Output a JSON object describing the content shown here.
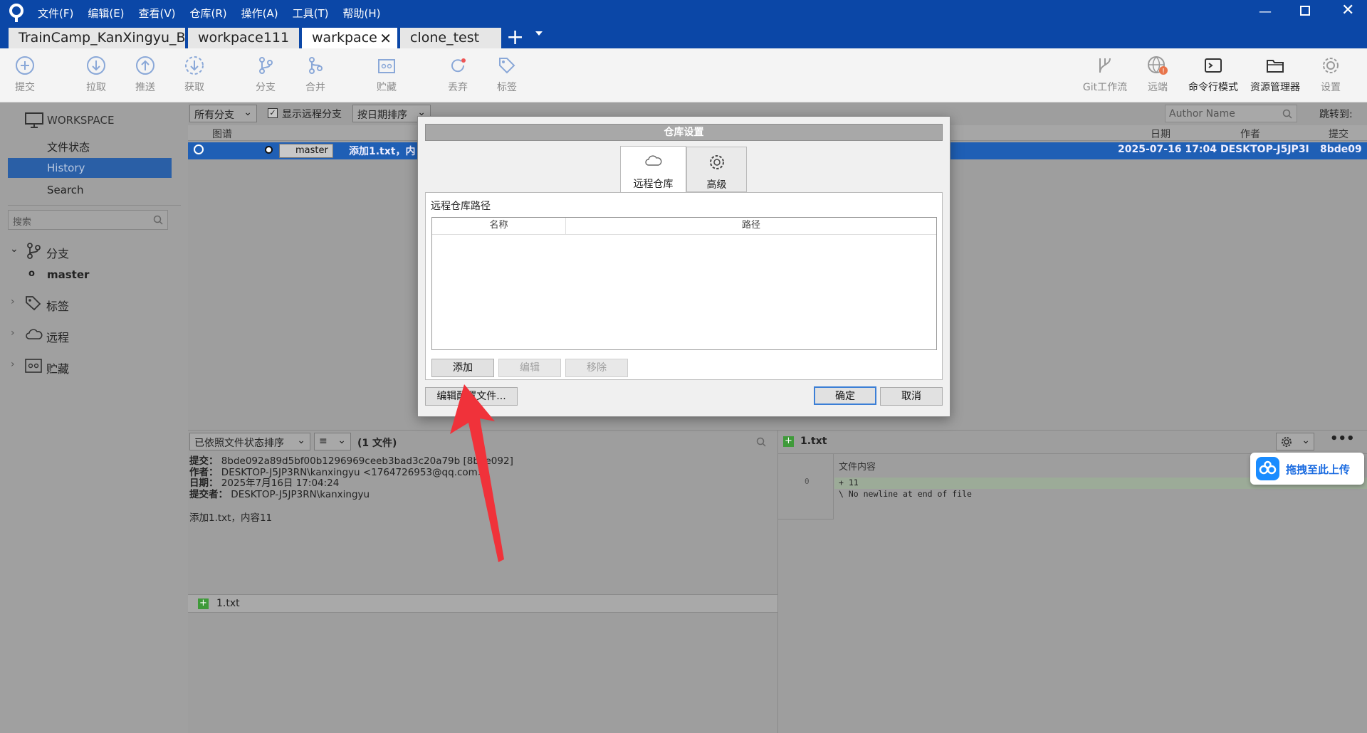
{
  "menu": [
    "文件(F)",
    "编辑(E)",
    "查看(V)",
    "仓库(R)",
    "操作(A)",
    "工具(T)",
    "帮助(H)"
  ],
  "tabs": [
    "TrainCamp_KanXingyu_B...",
    "workpace111",
    "warkpace",
    "clone_test"
  ],
  "toolbar": {
    "left": [
      "提交",
      "拉取",
      "推送",
      "获取",
      "分支",
      "合并",
      "贮藏",
      "丢弃",
      "标签"
    ],
    "right": [
      "Git工作流",
      "远端",
      "命令行模式",
      "资源管理器",
      "设置"
    ]
  },
  "sidebar": {
    "workspace": "WORKSPACE",
    "file_status": "文件状态",
    "history": "History",
    "search_item": "Search",
    "search_placeholder": "搜索",
    "branches": "分支",
    "master": "master",
    "tags": "标签",
    "remotes": "远程",
    "stashes": "贮藏"
  },
  "filterbar": {
    "all_branches": "所有分支",
    "show_remote": "显示远程分支",
    "sort": "按日期排序",
    "author_placeholder": "Author Name",
    "jump_to": "跳转到:"
  },
  "log": {
    "col_graph": "图谱",
    "col_date": "日期",
    "col_author": "作者",
    "col_commit": "提交",
    "row": {
      "branch": "master",
      "message": "添加1.txt，内",
      "date": "2025-07-16 17:04",
      "author": "DESKTOP-J5JP3I",
      "hash": "8bde09"
    }
  },
  "details": {
    "sort": "已依照文件状态排序",
    "list_icon": "≡",
    "file_count": "(1 文件)",
    "commit_label": "提交：",
    "commit_value": "8bde092a89d5bf00b1296969ceeb3bad3c20a79b [8bde092]",
    "author_label": "作者：",
    "author_value": "DESKTOP-J5JP3RN\\kanxingyu <1764726953@qq.com>",
    "date_label": "日期：",
    "date_value": "2025年7月16日 17:04:24",
    "committer_label": "提交者：",
    "committer_value": "DESKTOP-J5JP3RN\\kanxingyu",
    "message": "添加1.txt，内容11",
    "file": "1.txt"
  },
  "diff": {
    "file": "1.txt",
    "header": "文件内容",
    "line_no": "0",
    "added": "+ 11",
    "note": "\\ No newline at end of file",
    "upload": "拖拽至此上传"
  },
  "dialog": {
    "title": "仓库设置",
    "tab_remote": "远程仓库",
    "tab_advanced": "高级",
    "section": "远程仓库路径",
    "col_name": "名称",
    "col_path": "路径",
    "add": "添加",
    "edit": "编辑",
    "remove": "移除",
    "edit_config": "编辑配置文件...",
    "ok": "确定",
    "cancel": "取消"
  },
  "colors": {
    "titlebar": "#0b47a7",
    "selection": "#1f6fd1",
    "arrow": "#f0323a",
    "diff_added": "#cfe8c4"
  }
}
